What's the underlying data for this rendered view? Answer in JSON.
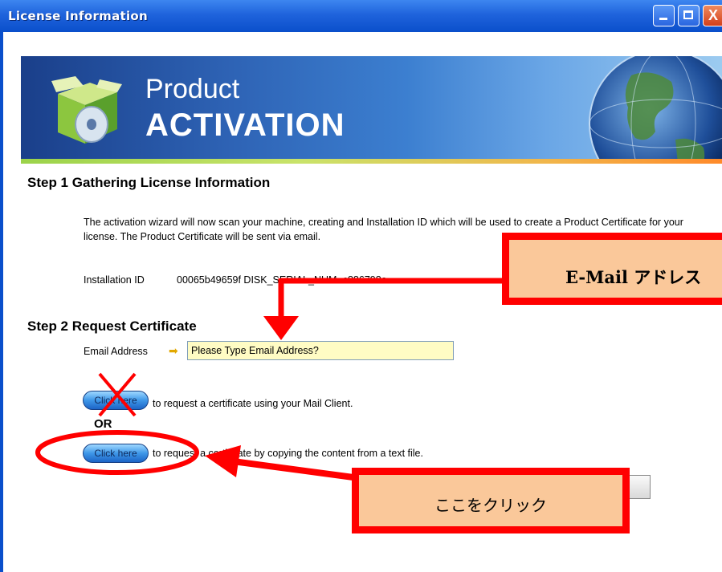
{
  "window": {
    "title": "License Information",
    "controls": [
      "minimize-icon",
      "maximize-icon",
      "close-icon"
    ],
    "close_glyph": "X"
  },
  "banner": {
    "line1": "Product",
    "line2": "ACTIVATION"
  },
  "step1": {
    "heading": "Step 1 Gathering License Information",
    "description": "The activation wizard will now scan your machine, creating and Installation ID which will be used to create a Product Certificate for your license. The Product Certificate will be sent via email.",
    "installation_id_label": "Installation ID",
    "installation_id_value": "00065b49659f DISK_SERIAL_NUM=c886798a"
  },
  "step2": {
    "heading": "Step 2 Request Certificate",
    "email_label": "Email Address",
    "email_value": "Please Type Email Address?",
    "option1_button": "Click here",
    "option1_text": "to request a certificate using your Mail Client.",
    "or_text": "OR",
    "option2_button": "Click here",
    "option2_text": "to request a certificate by copying the content from a text file."
  },
  "annotations": {
    "email_callout": "E-Mail アドレス",
    "click_callout": "ここをクリック",
    "accent_color": "#ff0000",
    "callout_fill": "#fac89a"
  }
}
